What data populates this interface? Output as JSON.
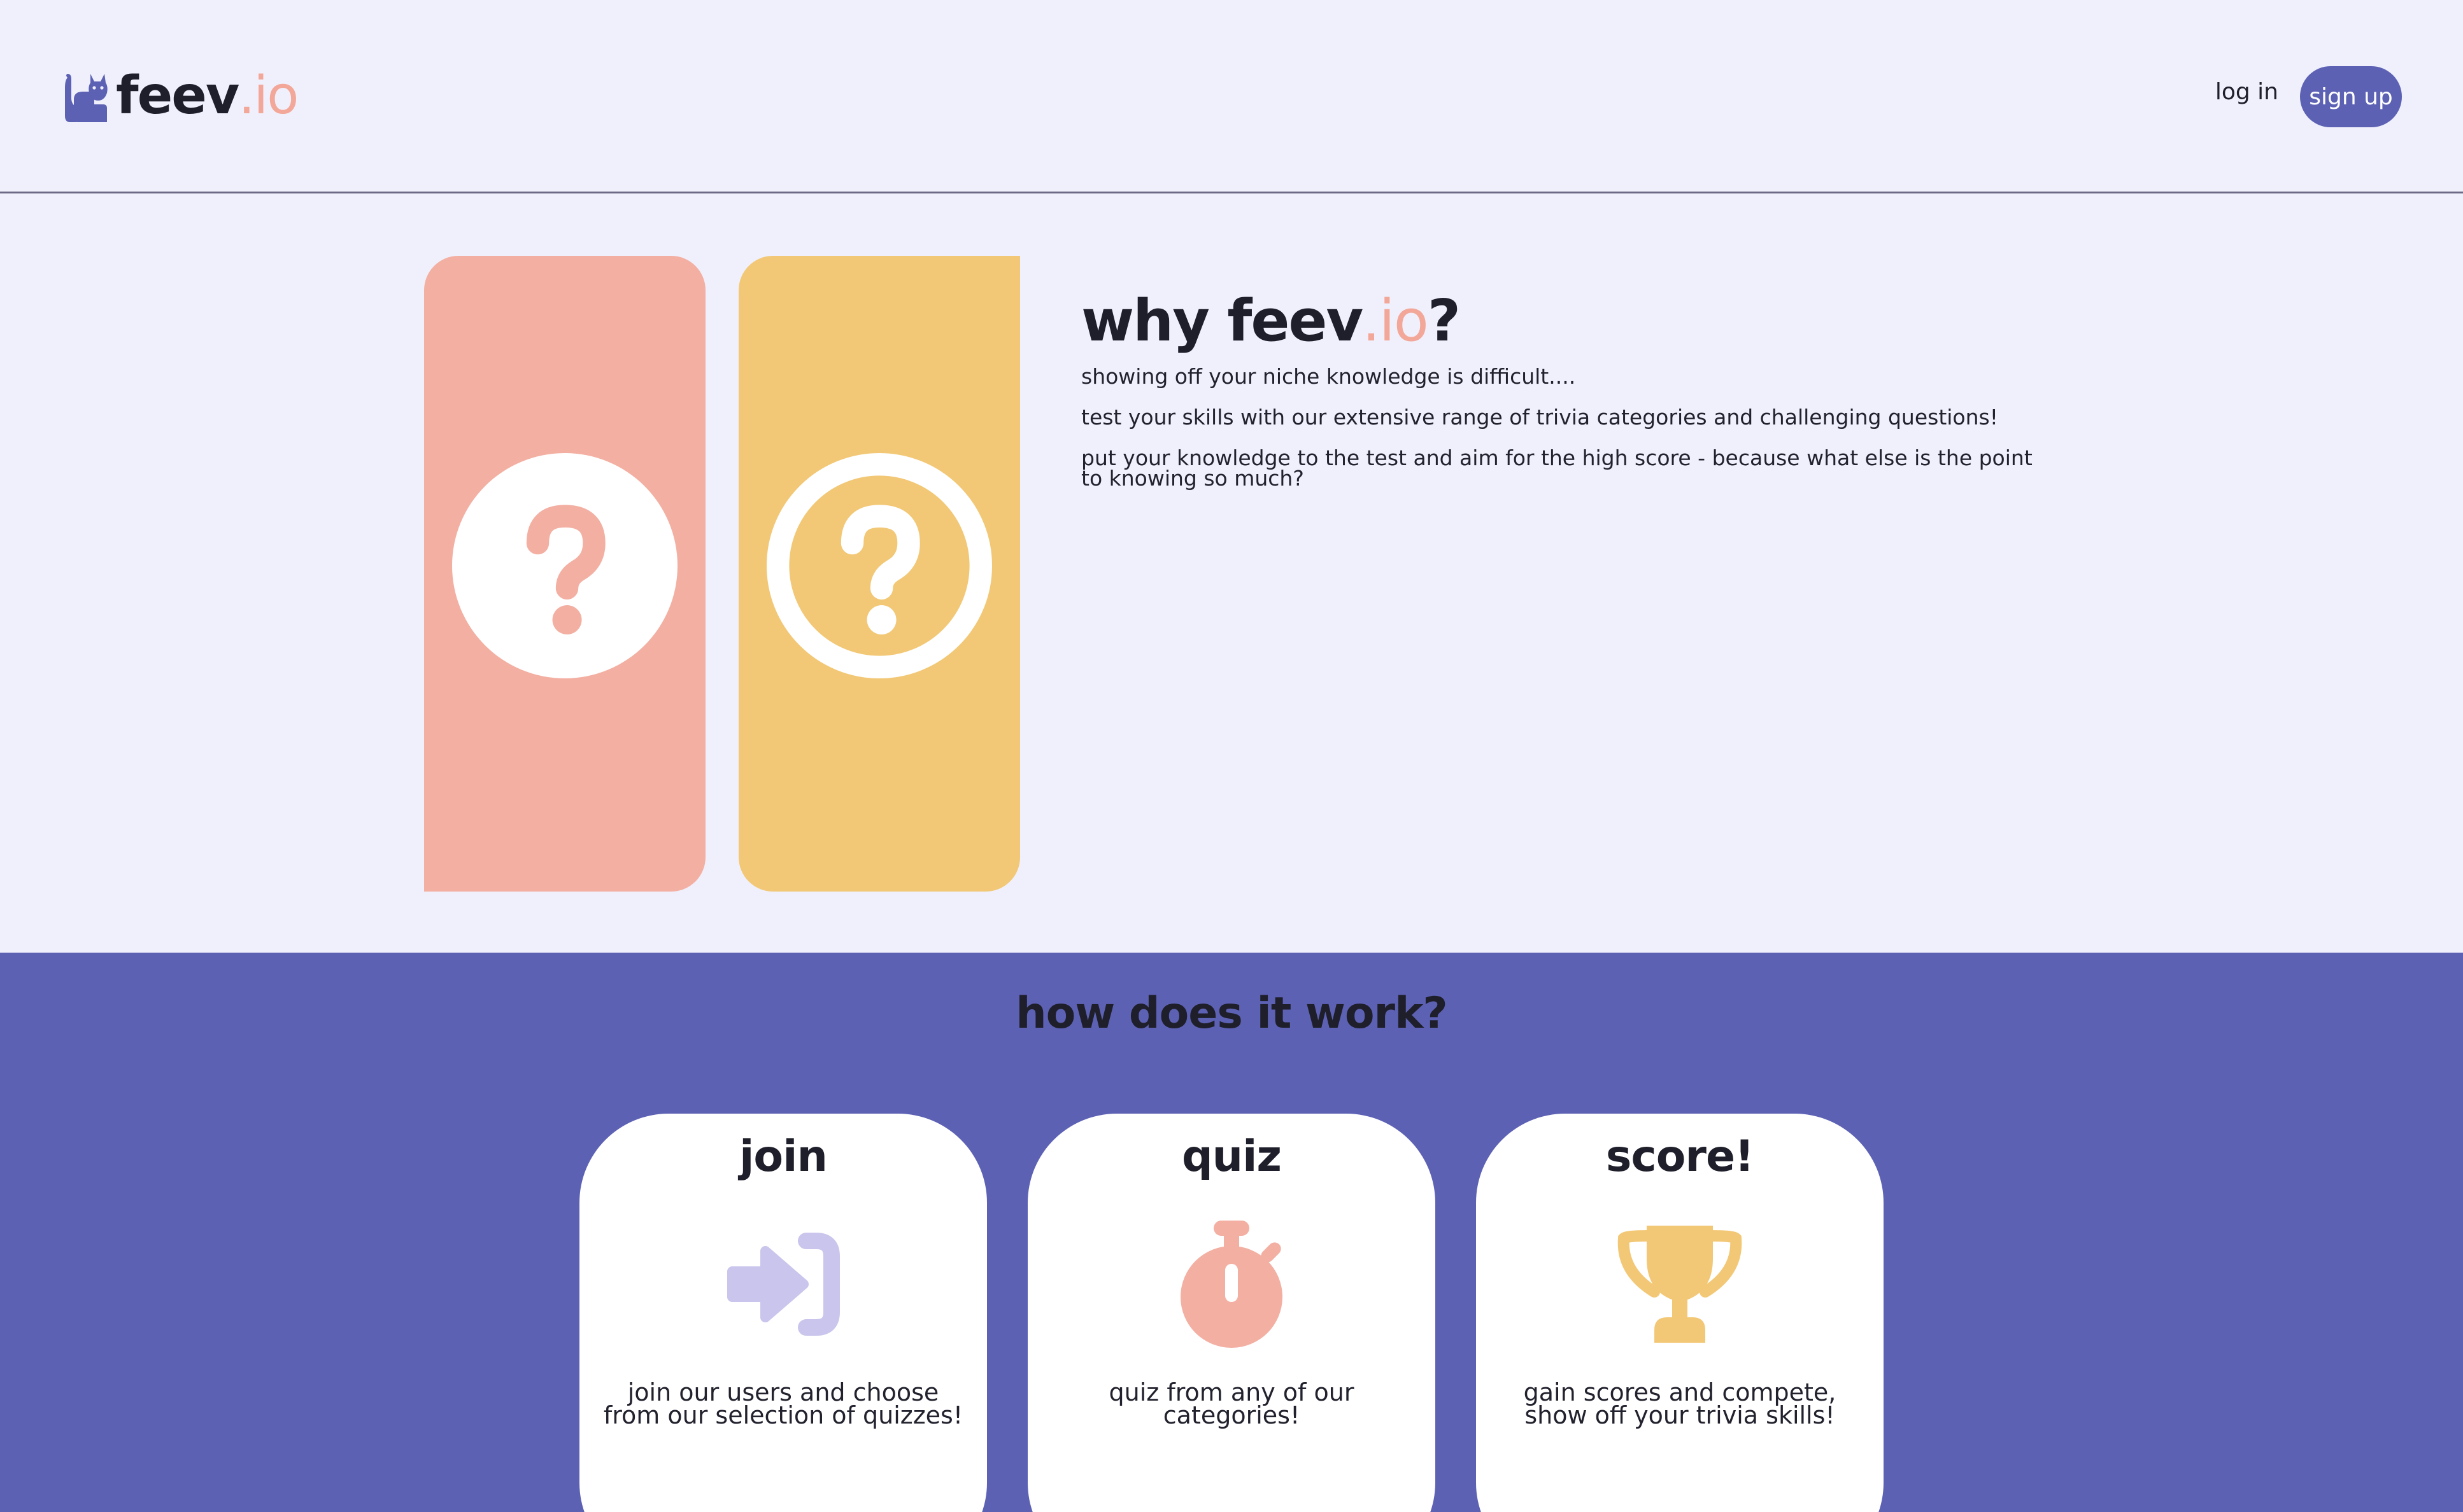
{
  "header": {
    "logo_name": "feev",
    "logo_tld": ".io",
    "login_label": "log in",
    "signup_label": "sign up"
  },
  "why": {
    "title_prefix": "why feev",
    "title_accent": ".io",
    "title_suffix": "?",
    "paragraphs": [
      "showing off your niche knowledge is difficult....",
      "test your skills with our extensive range of trivia categories and challenging questions!",
      "put your knowledge to the test and aim for the high score - because what else is the point to knowing so much?"
    ]
  },
  "how": {
    "title": "how does it work?",
    "cards": [
      {
        "title": "join",
        "icon": "sign-in-icon",
        "description": "join our users and choose from our selection of quizzes!"
      },
      {
        "title": "quiz",
        "icon": "stopwatch-icon",
        "description": "quiz from any of our categories!"
      },
      {
        "title": "score!",
        "icon": "trophy-icon",
        "description": "gain scores and compete, show off your trivia skills!"
      }
    ]
  },
  "colors": {
    "background": "#F0F0FC",
    "brand_purple": "#5C61B4",
    "accent_pink": "#F3AFA2",
    "accent_yellow": "#F2C876",
    "lavender": "#C9C5EC",
    "text": "#1F1F2B"
  }
}
